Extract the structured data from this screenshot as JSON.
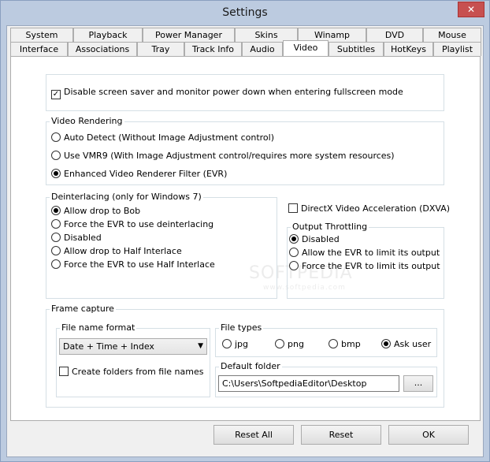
{
  "window": {
    "title": "Settings",
    "close_glyph": "✕"
  },
  "tabs_row1": [
    "System",
    "Playback",
    "Power Manager",
    "Skins",
    "Winamp",
    "DVD",
    "Mouse"
  ],
  "tabs_row2": [
    "Interface",
    "Associations",
    "Tray",
    "Track Info",
    "Audio",
    "Video",
    "Subtitles",
    "HotKeys",
    "Playlist"
  ],
  "active_tab": "Video",
  "screensaver": {
    "label": "Disable screen saver and monitor power down when entering fullscreen mode",
    "checked": true
  },
  "video_rendering": {
    "legend": "Video Rendering",
    "options": [
      "Auto Detect  (Without Image Adjustment control)",
      "Use VMR9 (With Image Adjustment control/requires more system resources)",
      "Enhanced Video Renderer Filter (EVR)"
    ],
    "selected": 2
  },
  "deinterlacing": {
    "legend": "Deinterlacing (only for Windows 7)",
    "options": [
      "Allow drop to Bob",
      "Force the EVR to use deinterlacing",
      "Disabled",
      "Allow drop to Half Interlace",
      "Force the EVR to use Half Interlace"
    ],
    "selected": 0
  },
  "dxva": {
    "label": "DirectX Video Acceleration (DXVA)",
    "checked": false
  },
  "output_throttling": {
    "legend": "Output Throttling",
    "options": [
      "Disabled",
      "Allow the EVR to limit its output",
      "Force the EVR to limit its output"
    ],
    "selected": 0
  },
  "frame_capture": {
    "legend": "Frame capture",
    "file_name_format": {
      "legend": "File name format",
      "value": "Date + Time + Index"
    },
    "create_folders": {
      "label": "Create folders from file names",
      "checked": false
    },
    "file_types": {
      "legend": "File types",
      "options": [
        "jpg",
        "png",
        "bmp",
        "Ask user"
      ],
      "selected": 3
    },
    "default_folder": {
      "legend": "Default folder",
      "value": "C:\\Users\\SoftpediaEditor\\Desktop",
      "browse_label": "..."
    }
  },
  "buttons": {
    "reset_all": "Reset All",
    "reset": "Reset",
    "ok": "OK"
  },
  "watermark": {
    "text": "SOFTPEDIA",
    "sub": "www.softpedia.com"
  }
}
